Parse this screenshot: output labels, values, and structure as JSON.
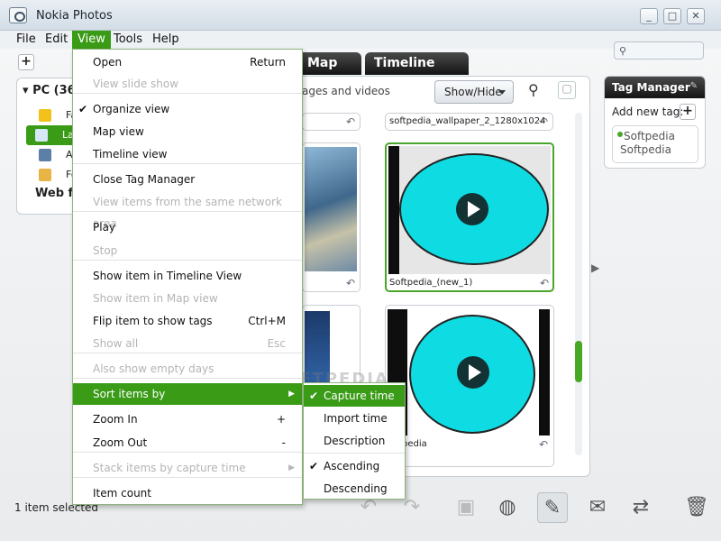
{
  "window": {
    "title": "Nokia Photos",
    "min_icon": "minimize-icon",
    "max_icon": "maximize-icon",
    "close_icon": "close-icon"
  },
  "menubar": [
    "File",
    "Edit",
    "View",
    "Tools",
    "Help"
  ],
  "tabs": [
    "Map",
    "Timeline"
  ],
  "left_panel": {
    "header": "PC (36",
    "rows": [
      "Fa",
      "La",
      "Al",
      "Fo"
    ],
    "web": "Web fe"
  },
  "center": {
    "header_text": "ages and videos",
    "showhide_label": "Show/Hide",
    "thumbs": {
      "top_label": "softpedia_wallpaper_2_1280x1024",
      "card1_label": "Softpedia_(new_1)",
      "card2_label": "pedia"
    }
  },
  "tag_manager": {
    "title": "Tag Manager",
    "add_label": "Add new tag:",
    "tag_lines": [
      "Softpedia",
      "Softpedia"
    ]
  },
  "status": "1 item selected",
  "view_menu": {
    "items": [
      {
        "label": "Open",
        "shortcut": "Return"
      },
      {
        "label": "View slide show",
        "disabled": true
      },
      {
        "label": "Organize view",
        "checked": true
      },
      {
        "label": "Map view"
      },
      {
        "label": "Timeline view"
      },
      {
        "label": "Close Tag Manager"
      },
      {
        "label": "View items from the same network area",
        "disabled": true
      },
      {
        "label": "Play"
      },
      {
        "label": "Stop",
        "disabled": true
      },
      {
        "label": "Show item in Timeline View"
      },
      {
        "label": "Show item in Map view",
        "disabled": true
      },
      {
        "label": "Flip item to show tags",
        "shortcut": "Ctrl+M"
      },
      {
        "label": "Show all",
        "shortcut": "Esc",
        "disabled": true
      },
      {
        "label": "Also show empty days",
        "disabled": true
      },
      {
        "label": "Sort items by",
        "submenu": true
      },
      {
        "label": "Zoom In",
        "shortcut": "+"
      },
      {
        "label": "Zoom Out",
        "shortcut": "-"
      },
      {
        "label": "Stack items by capture time",
        "submenu": true,
        "disabled": true
      },
      {
        "label": "Item count"
      }
    ]
  },
  "sort_submenu": {
    "items": [
      {
        "label": "Capture time",
        "checked": true
      },
      {
        "label": "Import time"
      },
      {
        "label": "Description"
      },
      {
        "label": "Ascending",
        "checked": true
      },
      {
        "label": "Descending"
      }
    ]
  },
  "watermark": "SOFTPEDIA",
  "colors": {
    "accent": "#3a9b17",
    "clock": "#0fdbe3"
  }
}
